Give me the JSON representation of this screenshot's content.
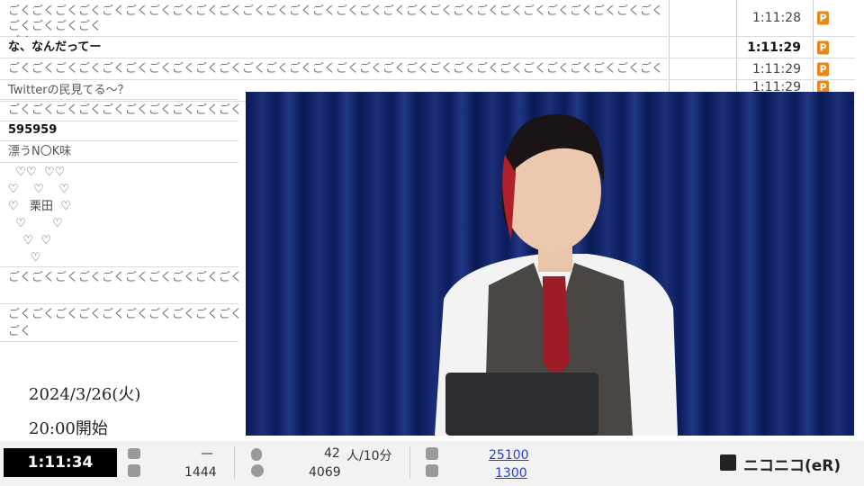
{
  "comments_top": [
    {
      "text": "ごくごくごくごくごくごくごくごくごくごくごくごくごくごくごくごくごくごくごくごくごくごくごくごくごくごくごくごくごくごくごくごく\nごく",
      "time": "1:11:28",
      "badge": "P",
      "bold": false
    },
    {
      "text": "な、なんだってー",
      "time": "1:11:29",
      "badge": "P",
      "bold": true
    },
    {
      "text": "ごくごくごくごくごくごくごくごくごくごくごくごくごくごくごくごくごくごくごくごくごくごくごくごくごくごくごくごくごくごく",
      "time": "1:11:29",
      "badge": "P",
      "bold": false
    },
    {
      "text": "",
      "time": "1:11:29",
      "badge": "P",
      "bold": false
    }
  ],
  "comments_left": [
    "Twitterの民見てる～？",
    "ごくごくごくごくごくごくごくごくごくごくごく",
    "595959",
    "漂うN〇K味",
    "  ♡♡  ♡♡\n♡    ♡    ♡\n♡   栗田  ♡\n  ♡       ♡\n    ♡  ♡\n      ♡",
    "ごくごくごくごくごくごくごくごくごくごくごく",
    "ごくごくごくごくごくごくごくごくごくごくごく\nごく"
  ],
  "overlay": {
    "date": "2024/3/26(火)",
    "start": "20:00開始"
  },
  "status": {
    "elapsed": "1:11:34",
    "comments_recent": "—",
    "comments_total": "1444",
    "active": "42",
    "active_unit": "人/10分",
    "visitors": "4069",
    "ad_points": "25100",
    "gift_points": "1300",
    "logo": "ニコニコ(eR)"
  }
}
